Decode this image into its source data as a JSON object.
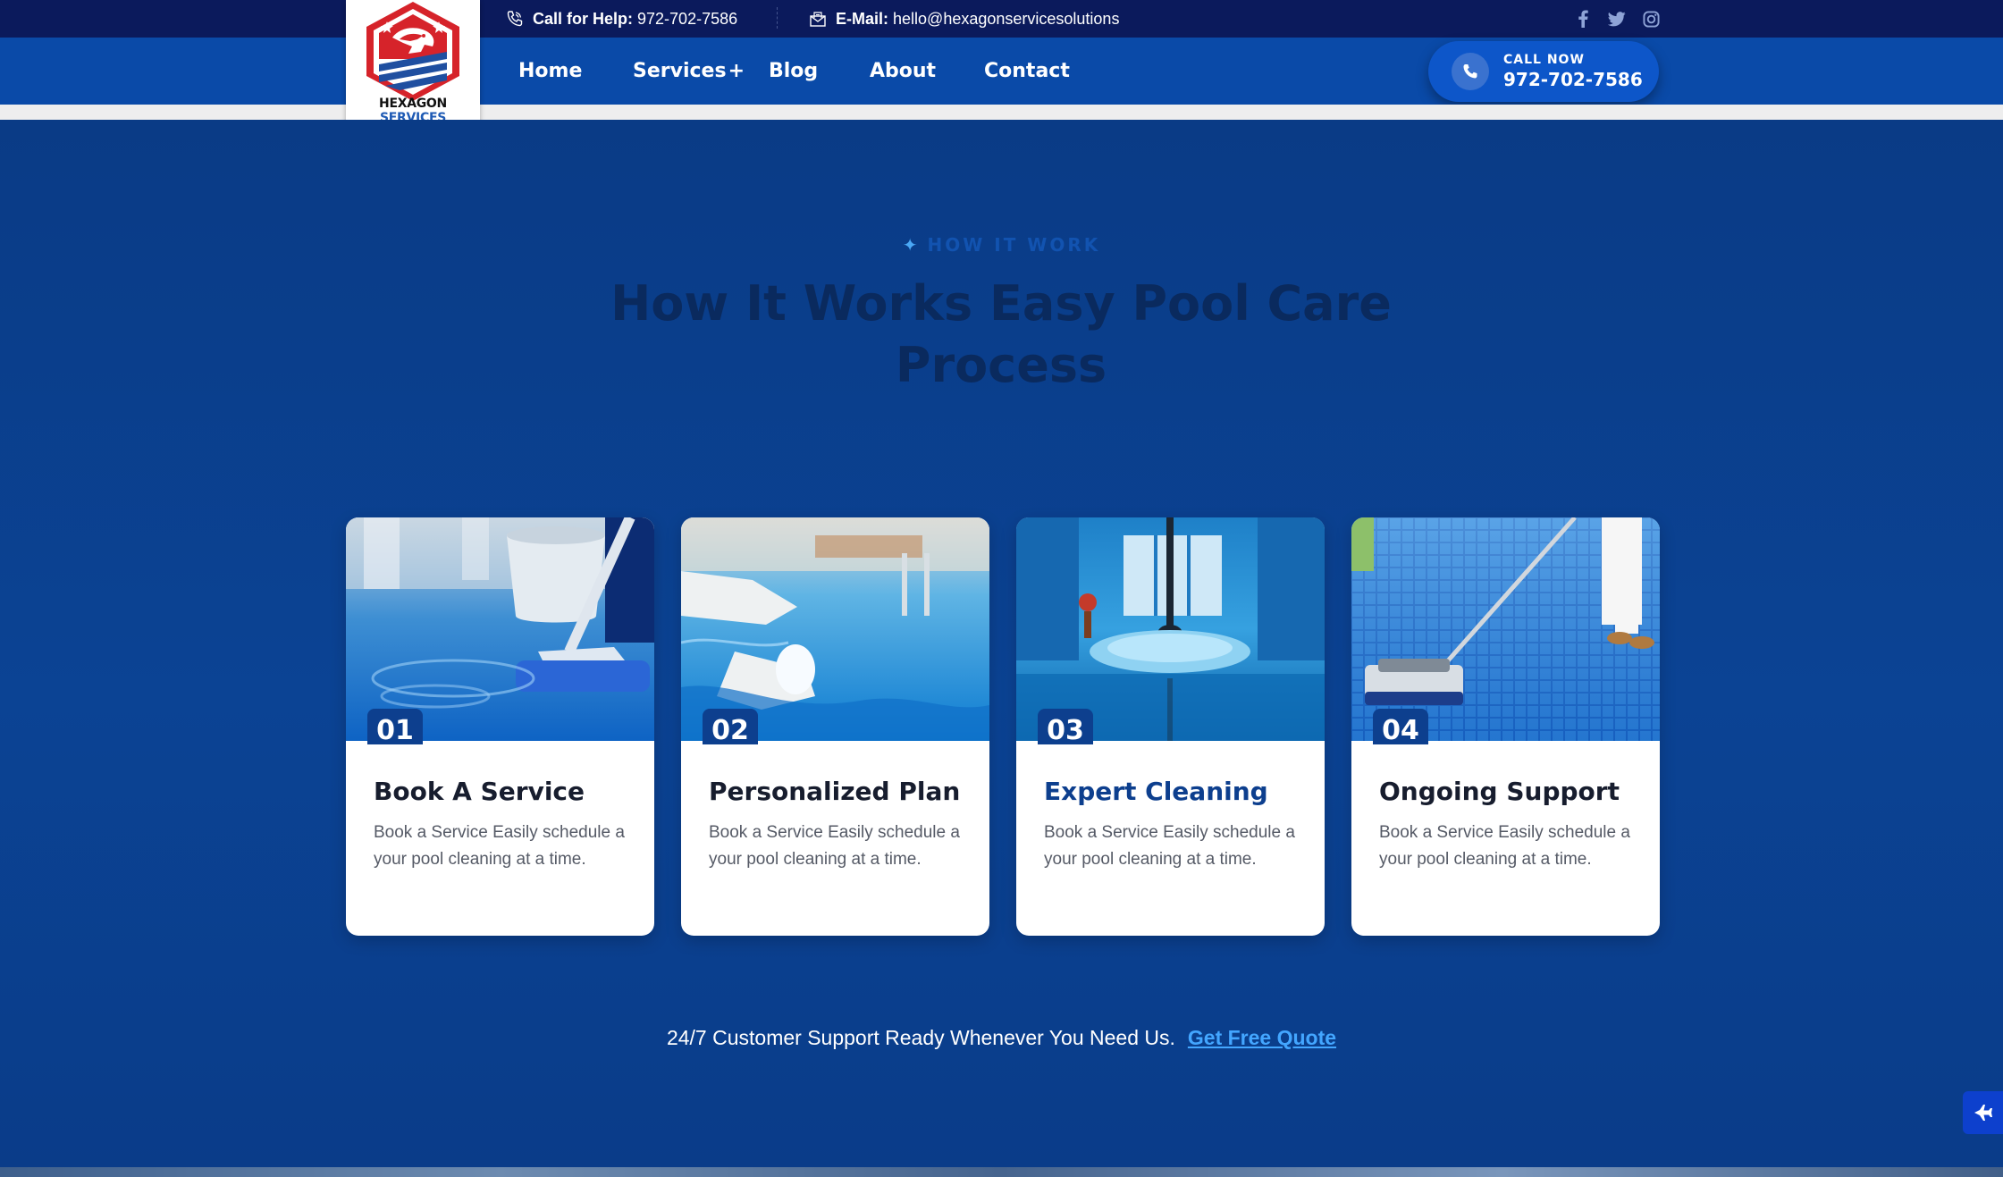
{
  "topbar": {
    "call_label": "Call for Help:",
    "call_value": "972-702-7586",
    "email_label": "E-Mail:",
    "email_value": "hello@hexagonservicesolutions",
    "social": [
      "facebook-icon",
      "twitter-icon",
      "instagram-icon"
    ]
  },
  "logo": {
    "text_black": "HEXAGON",
    "text_blue": "SERVICES"
  },
  "nav": {
    "items": [
      {
        "label": "Home"
      },
      {
        "label": "Services"
      },
      {
        "label": "Blog"
      },
      {
        "label": "About"
      },
      {
        "label": "Contact"
      }
    ],
    "services_suffix": "+",
    "call_now_label": "CALL NOW",
    "call_now_number": "972-702-7586"
  },
  "section": {
    "eyebrow": "HOW IT WORK",
    "heading": "How It Works Easy Pool Care Process",
    "cards": [
      {
        "num": "01",
        "title": "Book A Service",
        "desc": "Book a Service Easily schedule a your pool cleaning at a time."
      },
      {
        "num": "02",
        "title": "Personalized Plan",
        "desc": "Book a Service Easily schedule a your pool cleaning at a time."
      },
      {
        "num": "03",
        "title": "Expert Cleaning",
        "desc": "Book a Service Easily schedule a your pool cleaning at a time."
      },
      {
        "num": "04",
        "title": "Ongoing Support",
        "desc": "Book a Service Easily schedule a your pool cleaning at a time."
      }
    ],
    "support_text": "24/7 Customer Support Ready Whenever You Need Us.",
    "support_link": "Get Free Quote"
  },
  "colors": {
    "topbar": "#0b1a5c",
    "navbar": "#0a4aa8",
    "section": "#0a3b86",
    "accent": "#43a6ff",
    "card_number": "#0d3f8e"
  }
}
